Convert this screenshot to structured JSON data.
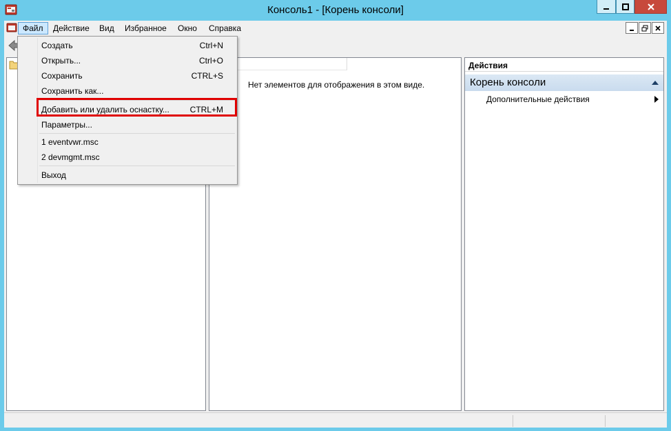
{
  "window": {
    "title": "Консоль1 - [Корень консоли]"
  },
  "menubar": {
    "items": [
      {
        "label": "Файл"
      },
      {
        "label": "Действие"
      },
      {
        "label": "Вид"
      },
      {
        "label": "Избранное"
      },
      {
        "label": "Окно"
      },
      {
        "label": "Справка"
      }
    ]
  },
  "file_menu": {
    "items": [
      {
        "label": "Создать",
        "shortcut": "Ctrl+N"
      },
      {
        "label": "Открыть...",
        "shortcut": "Ctrl+O"
      },
      {
        "label": "Сохранить",
        "shortcut": "CTRL+S"
      },
      {
        "label": "Сохранить как...",
        "shortcut": ""
      },
      {
        "label": "Добавить или удалить оснастку...",
        "shortcut": "CTRL+M"
      },
      {
        "label": "Параметры...",
        "shortcut": ""
      },
      {
        "label": "1 eventvwr.msc",
        "shortcut": ""
      },
      {
        "label": "2 devmgmt.msc",
        "shortcut": ""
      },
      {
        "label": "Выход",
        "shortcut": ""
      }
    ]
  },
  "middle_pane": {
    "empty_text": "Нет элементов для отображения в этом виде."
  },
  "actions_pane": {
    "header": "Действия",
    "section_title": "Корень консоли",
    "more_actions": "Дополнительные действия"
  },
  "colors": {
    "window_frame": "#6ccbea",
    "close_button": "#c7493c",
    "highlight_box": "#e00000",
    "menu_active": "#cce8ff"
  },
  "icons": {
    "app": "mmc-console-icon",
    "back": "back-arrow-icon",
    "tree_root": "folder-icon",
    "collapse": "chevron-up-icon",
    "submenu": "chevron-right-icon"
  }
}
